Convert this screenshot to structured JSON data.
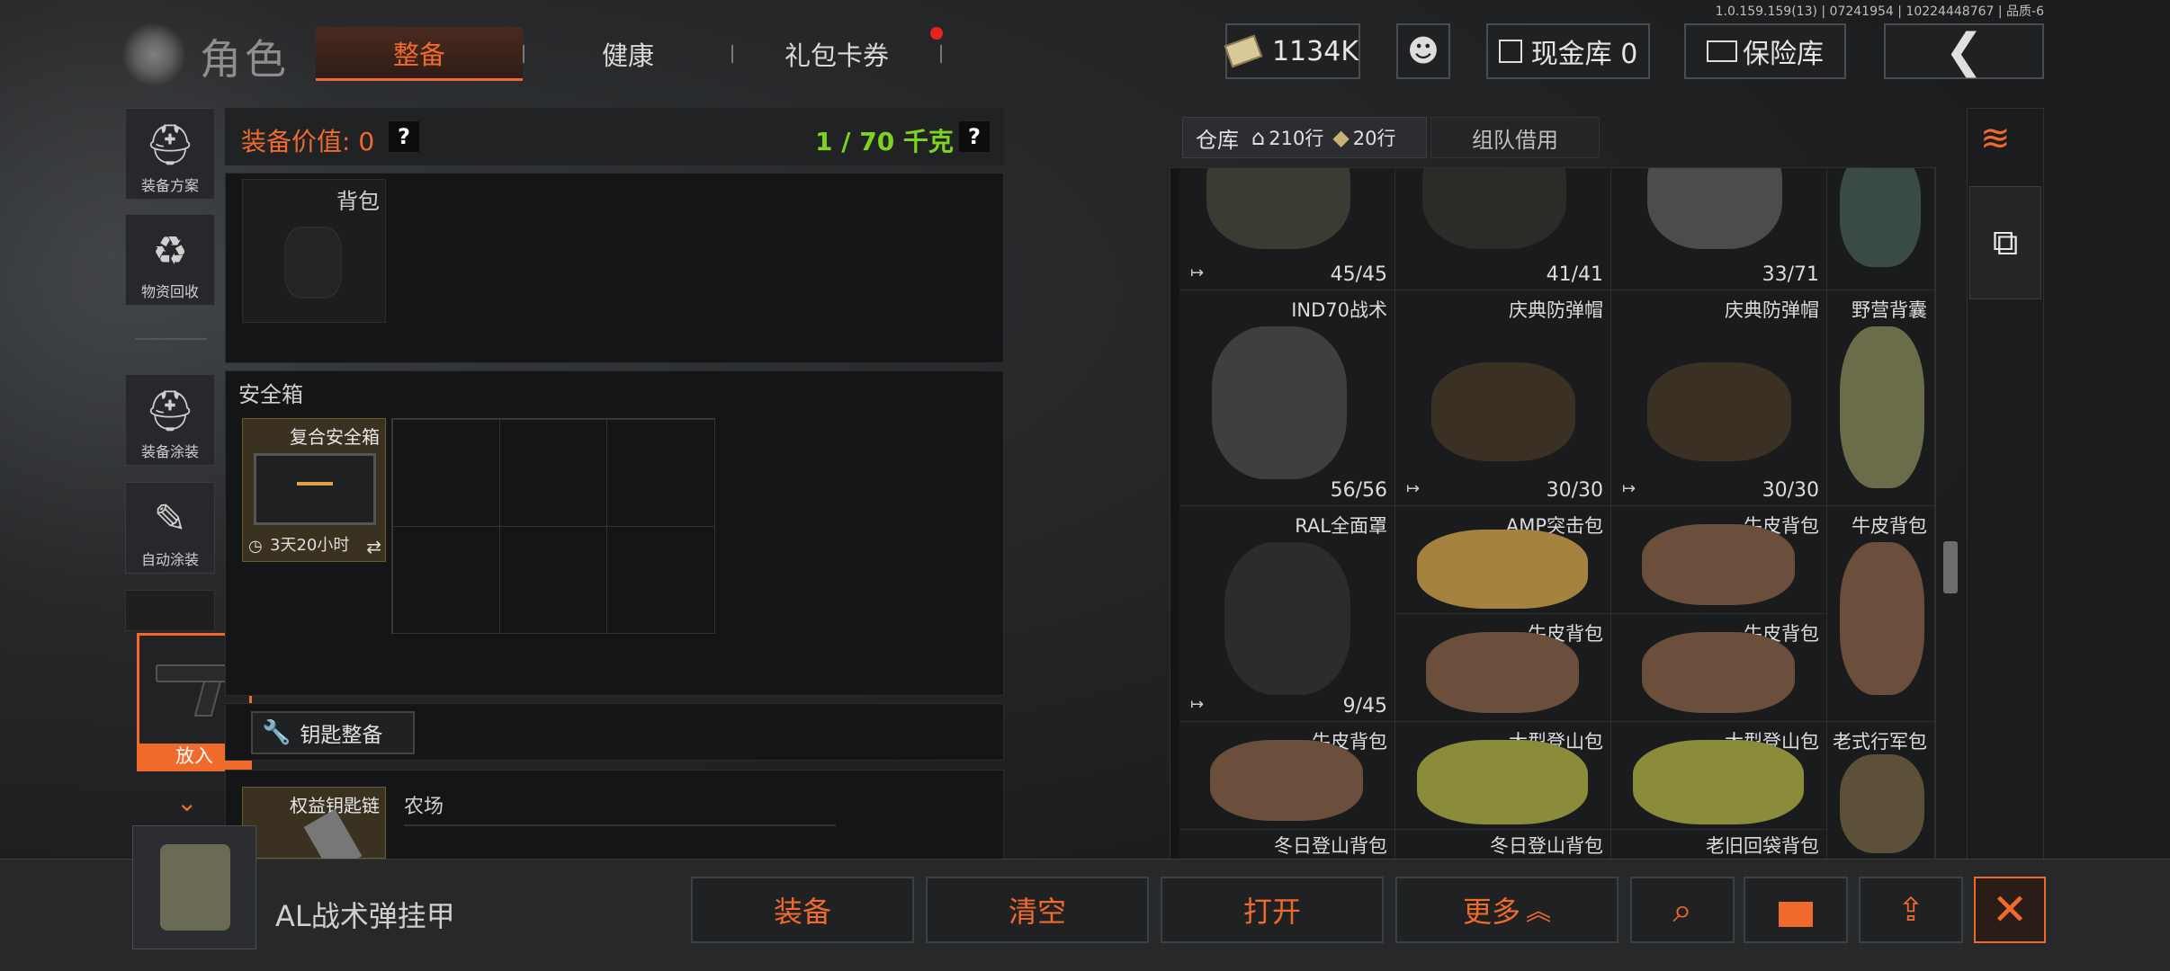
{
  "version": "1.0.159.159(13) | 07241954 | 10224448767 | 品质-6",
  "header": {
    "title": "角色",
    "tabs": [
      "整备",
      "健康",
      "礼包卡券"
    ],
    "money": "1134K",
    "cash_vault": "现金库 0",
    "insurance": "保险库"
  },
  "sidebar": {
    "items": [
      "装备方案",
      "物资回收",
      "装备涂装",
      "自动涂装"
    ],
    "put_in": "放入"
  },
  "equip": {
    "value_label": "装备价值: 0",
    "weight_label": "1 / 70 千克",
    "help": "?",
    "backpack_label": "背包",
    "safebox_section": "安全箱",
    "safebox_item": "复合安全箱",
    "safebox_timer": "3天20小时",
    "key_button": "钥匙整备",
    "key_item": "权益钥匙链",
    "farm_label": "农场"
  },
  "warehouse": {
    "tab_main": "仓库",
    "rows1": "210行",
    "rows2": "20行",
    "tab_team": "组队借用",
    "items": [
      {
        "name": "",
        "count": "45/45"
      },
      {
        "name": "",
        "count": "41/41"
      },
      {
        "name": "",
        "count": "33/71"
      },
      {
        "name": "",
        "count": ""
      },
      {
        "name": "IND70战术",
        "count": "56/56"
      },
      {
        "name": "庆典防弹帽",
        "count": "30/30"
      },
      {
        "name": "庆典防弹帽",
        "count": "30/30"
      },
      {
        "name": "野营背囊",
        "count": ""
      },
      {
        "name": "RAL全面罩",
        "count": "9/45"
      },
      {
        "name": "AMP突击包",
        "count": ""
      },
      {
        "name": "牛皮背包",
        "count": ""
      },
      {
        "name": "牛皮背包",
        "count": ""
      },
      {
        "name": "牛皮背包",
        "count": ""
      },
      {
        "name": "牛皮背包",
        "count": ""
      },
      {
        "name": "牛皮背包",
        "count": ""
      },
      {
        "name": "大型登山包",
        "count": ""
      },
      {
        "name": "大型登山包",
        "count": ""
      },
      {
        "name": "老式行军包",
        "count": ""
      },
      {
        "name": "冬日登山背包",
        "count": ""
      },
      {
        "name": "冬日登山背包",
        "count": ""
      },
      {
        "name": "老旧回袋背包",
        "count": ""
      }
    ]
  },
  "bottom": {
    "selected_item": "AL战术弹挂甲",
    "equip": "装备",
    "clear": "清空",
    "open": "打开",
    "more": "更多"
  }
}
